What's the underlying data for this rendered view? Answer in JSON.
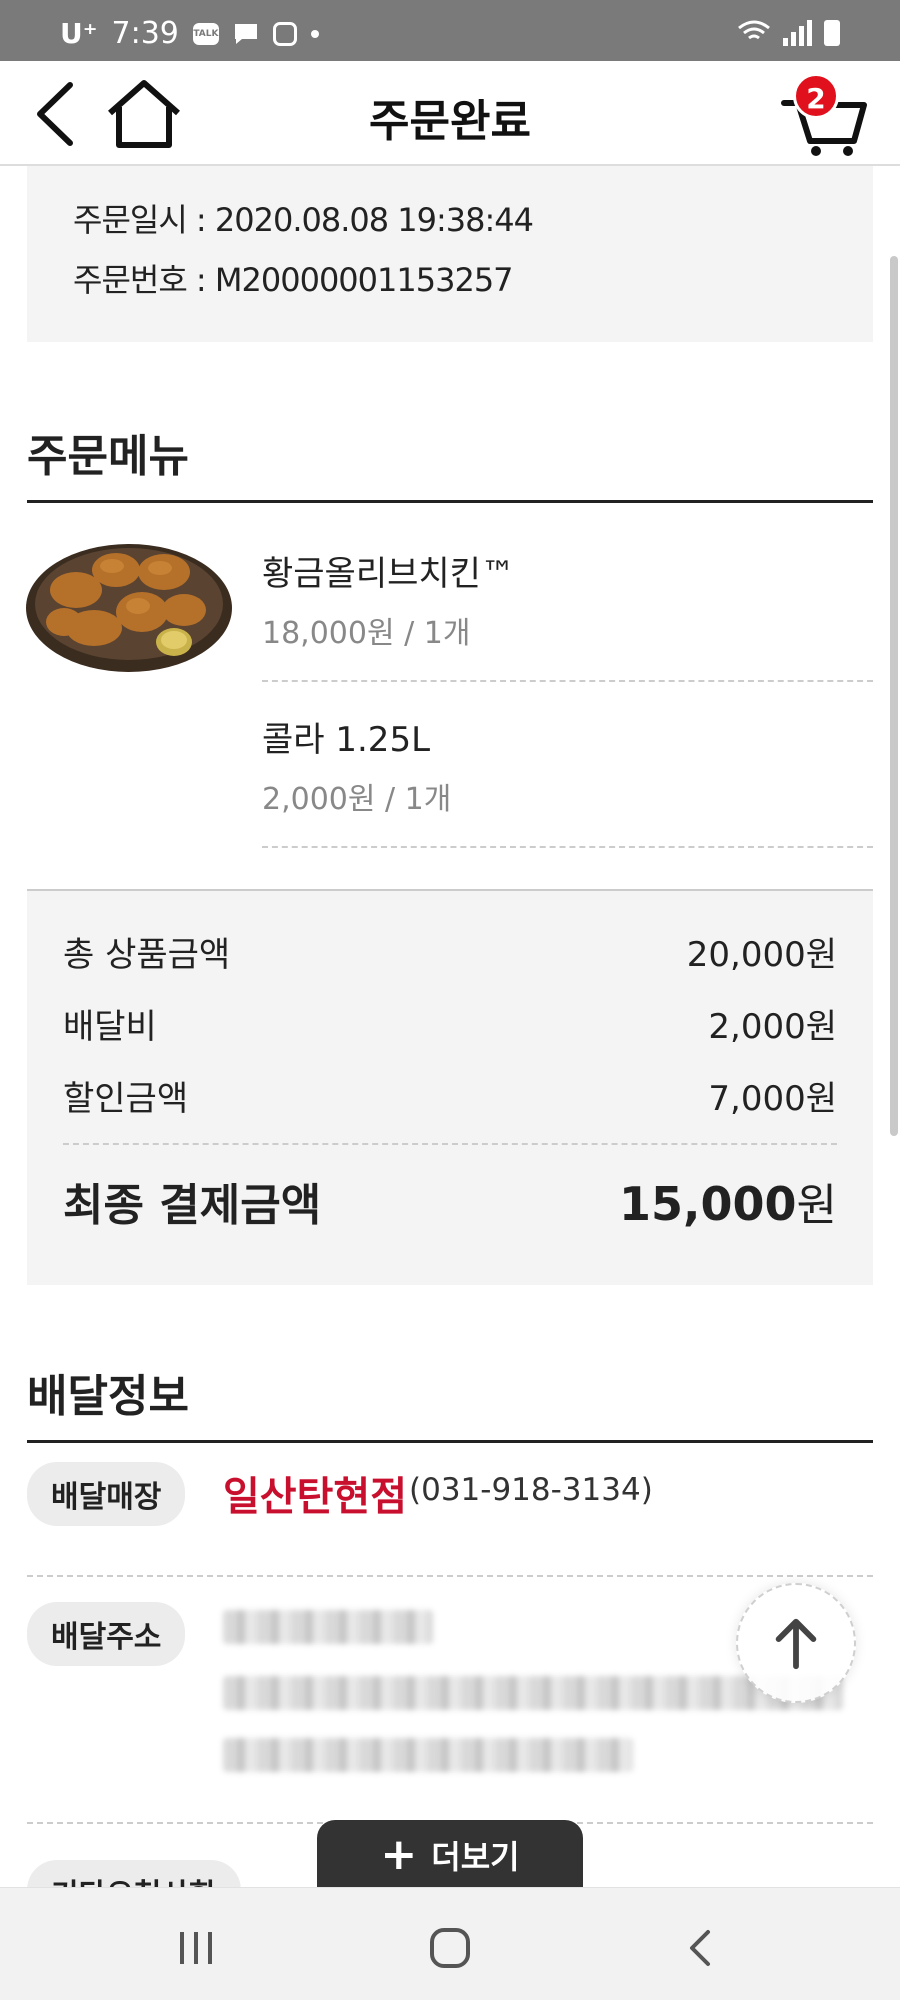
{
  "status_bar": {
    "carrier": "U⁺",
    "time": "7:39",
    "talk_label": "TALK",
    "icons": [
      "talk-icon",
      "message-icon",
      "instagram-icon",
      "dot-icon",
      "wifi-icon",
      "signal-icon",
      "battery-icon"
    ]
  },
  "header": {
    "title": "주문완료",
    "cart_count": "2",
    "icons": [
      "back-arrow-icon",
      "home-icon",
      "cart-icon"
    ]
  },
  "order_info": {
    "datetime_label": "주문일시 : ",
    "datetime": "2020.08.08 19:38:44",
    "number_label": "주문번호 : ",
    "number": "M20000001153257"
  },
  "order_menu": {
    "title": "주문메뉴",
    "items": [
      {
        "name": "황금올리브치킨™",
        "price": "18,000원 / 1개"
      },
      {
        "name": "콜라 1.25L",
        "price": "2,000원 / 1개"
      }
    ]
  },
  "totals": {
    "subtotal_label": "총 상품금액",
    "subtotal": "20,000원",
    "delivery_label": "배달비",
    "delivery": "2,000원",
    "discount_label": "할인금액",
    "discount": "7,000원",
    "final_label": "최종 결제금액",
    "final_number": "15,000",
    "final_unit": "원"
  },
  "delivery_info": {
    "title": "배달정보",
    "store_label": "배달매장",
    "store_name": "일산탄현점",
    "store_phone": "(031-918-3134)",
    "address_label": "배달주소",
    "request_label": "기타요청사항"
  },
  "more_button": {
    "label": "더보기"
  },
  "colors": {
    "accent_red": "#c8102e",
    "badge_red": "#e0101c",
    "panel_gray": "#f4f4f4",
    "button_dark": "#333333"
  }
}
